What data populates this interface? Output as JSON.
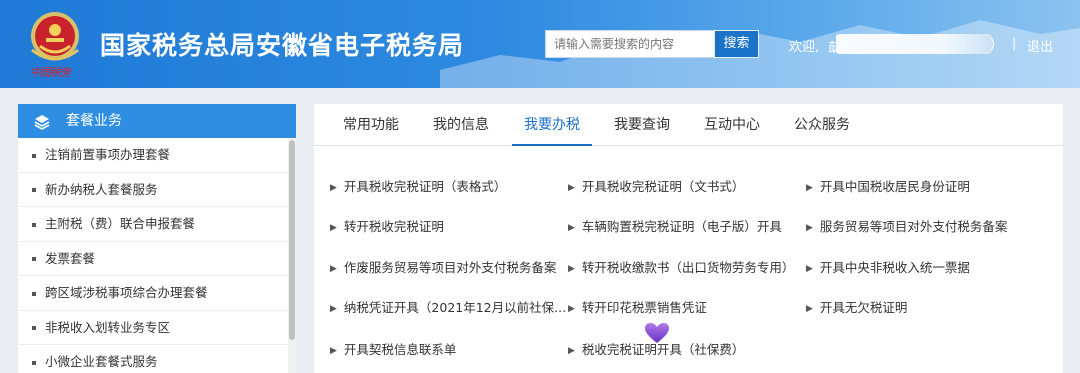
{
  "header": {
    "title": "国家税务总局安徽省电子税务局",
    "emblem_caption": "中国税务",
    "search_placeholder": "请输入需要搜索的内容",
    "search_button": "搜索",
    "welcome": "欢迎,",
    "user_name_fragment": "莇",
    "user_suffix": ")",
    "separator": "|",
    "logout": "退出",
    "accent_color": "#2b84de"
  },
  "sidebar": {
    "title": "套餐业务",
    "items": [
      "注销前置事项办理套餐",
      "新办纳税人套餐服务",
      "主附税（费）联合申报套餐",
      "发票套餐",
      "跨区域涉税事项综合办理套餐",
      "非税收入划转业务专区",
      "小微企业套餐式服务"
    ]
  },
  "tabs": [
    "常用功能",
    "我的信息",
    "我要办税",
    "我要查询",
    "互动中心",
    "公众服务"
  ],
  "active_tab": "我要办税",
  "links": [
    [
      "开具税收完税证明（表格式）",
      "开具税收完税证明（文书式）",
      "开具中国税收居民身份证明"
    ],
    [
      "转开税收完税证明",
      "车辆购置税完税证明（电子版）开具",
      "服务贸易等项目对外支付税务备案"
    ],
    [
      "作废服务贸易等项目对外支付税务备案",
      "转开税收缴款书（出口货物劳务专用）",
      "开具中央非税收入统一票据"
    ],
    [
      "纳税凭证开具（2021年12月以前社保...",
      "转开印花税票销售凭证",
      "开具无欠税证明"
    ],
    [
      "开具契税信息联系单",
      "税收完税证明开具（社保费）"
    ]
  ]
}
